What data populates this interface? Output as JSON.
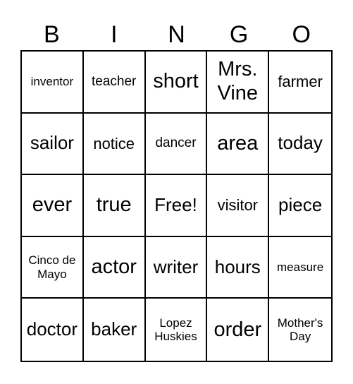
{
  "header": [
    "B",
    "I",
    "N",
    "G",
    "O"
  ],
  "cells": [
    [
      {
        "text": "inventor",
        "size": "xxs"
      },
      {
        "text": "teacher",
        "size": "xs"
      },
      {
        "text": "short",
        "size": "l"
      },
      {
        "text": "Mrs. Vine",
        "size": "l"
      },
      {
        "text": "farmer",
        "size": "s"
      }
    ],
    [
      {
        "text": "sailor",
        "size": "m"
      },
      {
        "text": "notice",
        "size": "s"
      },
      {
        "text": "dancer",
        "size": "xs"
      },
      {
        "text": "area",
        "size": "l"
      },
      {
        "text": "today",
        "size": "m"
      }
    ],
    [
      {
        "text": "ever",
        "size": "l"
      },
      {
        "text": "true",
        "size": "l"
      },
      {
        "text": "Free!",
        "size": "m"
      },
      {
        "text": "visitor",
        "size": "s"
      },
      {
        "text": "piece",
        "size": "m"
      }
    ],
    [
      {
        "text": "Cinco de Mayo",
        "size": "xxs"
      },
      {
        "text": "actor",
        "size": "l"
      },
      {
        "text": "writer",
        "size": "m"
      },
      {
        "text": "hours",
        "size": "m"
      },
      {
        "text": "measure",
        "size": "xxs"
      }
    ],
    [
      {
        "text": "doctor",
        "size": "m"
      },
      {
        "text": "baker",
        "size": "m"
      },
      {
        "text": "Lopez Huskies",
        "size": "xxs"
      },
      {
        "text": "order",
        "size": "l"
      },
      {
        "text": "Mother's Day",
        "size": "xxs"
      }
    ]
  ]
}
